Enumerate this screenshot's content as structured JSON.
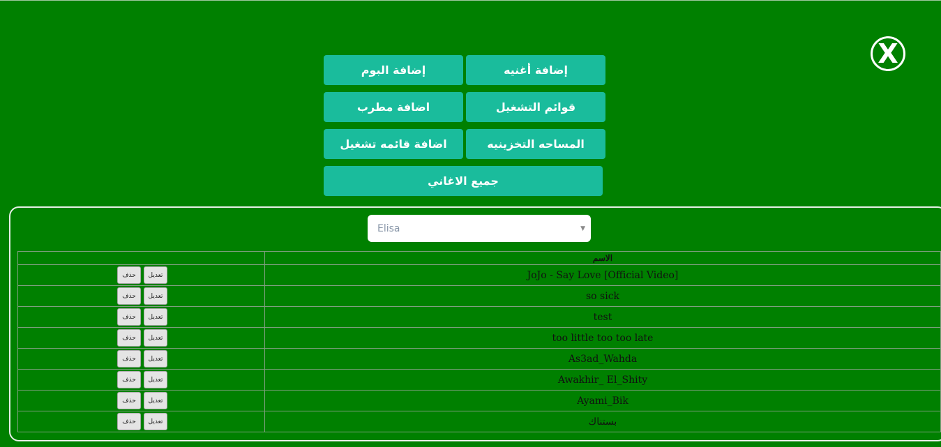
{
  "close_glyph": "X",
  "menu": {
    "add_song": "إضافة أغنيه",
    "add_album": "إضافة البوم",
    "playlists": "قوائم التشغيل",
    "add_artist": "اضافة مطرب",
    "storage_space": "المساحه التخزينيه",
    "add_playlist": "اضافة قائمه تشغيل",
    "all_songs": "جميع الاغاني"
  },
  "artist_select": {
    "selected": "Elisa",
    "caret": "▼"
  },
  "table": {
    "header_name": "الاسم",
    "edit_label": "تعديل",
    "delete_label": "حذف",
    "rows": [
      "JoJo - Say Love [Official Video]",
      "so sick",
      "test",
      "too little too too late",
      "As3ad_Wahda",
      "Awakhir_ El_Shity",
      "Ayami_Bik",
      "بستناك"
    ]
  },
  "colors": {
    "background": "#008000",
    "button": "#1abc9c",
    "text_light": "#ffffff"
  }
}
